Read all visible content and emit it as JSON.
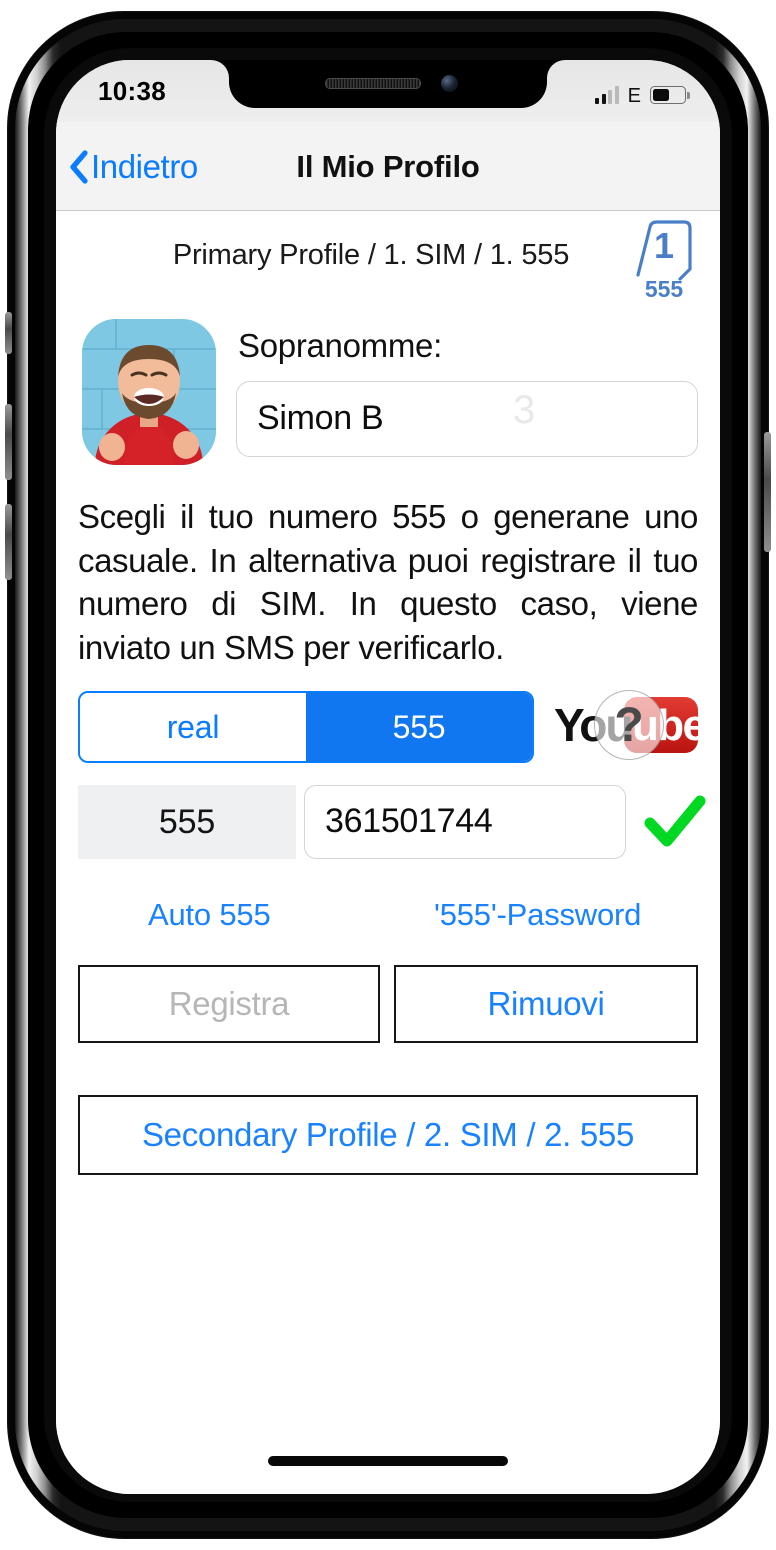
{
  "status_bar": {
    "time": "10:38",
    "network_label": "E",
    "signal_bars_total": 4,
    "signal_bars_active": 2,
    "battery_percent": 47
  },
  "nav_bar": {
    "back_label": "Indietro",
    "title": "Il Mio Profilo"
  },
  "profile_header": {
    "path": "Primary Profile / 1. SIM / 1. 555",
    "sim_badge_number": "1",
    "sim_badge_sub": "555",
    "badge_color": "#4a7fc7"
  },
  "nickname": {
    "label": "Sopranomme:",
    "value": "Simon B",
    "watermark": "3"
  },
  "description": "Scegli il tuo numero 555 o generane uno casuale. In alternativa puoi registrare il tuo numero di SIM. In questo caso, viene inviato un SMS per verificarlo.",
  "segmented_control": {
    "options": [
      "real",
      "555"
    ],
    "selected": "555",
    "accent_color": "#0a7cff",
    "selected_bg": "#1177f0"
  },
  "youtube_badge": {
    "text_part1": "You",
    "text_part2": "ube",
    "overlay_glyph": "?",
    "red": "#d01f1a"
  },
  "number_row": {
    "prefix": "555",
    "value": "361501744",
    "validated": true,
    "check_color": "#00d821"
  },
  "links": {
    "auto": "Auto 555",
    "password": "'555'-Password"
  },
  "actions": {
    "register": "Registra",
    "register_enabled": false,
    "remove": "Rimuovi",
    "remove_enabled": true
  },
  "secondary_profile": {
    "label": "Secondary Profile / 2. SIM / 2. 555"
  }
}
